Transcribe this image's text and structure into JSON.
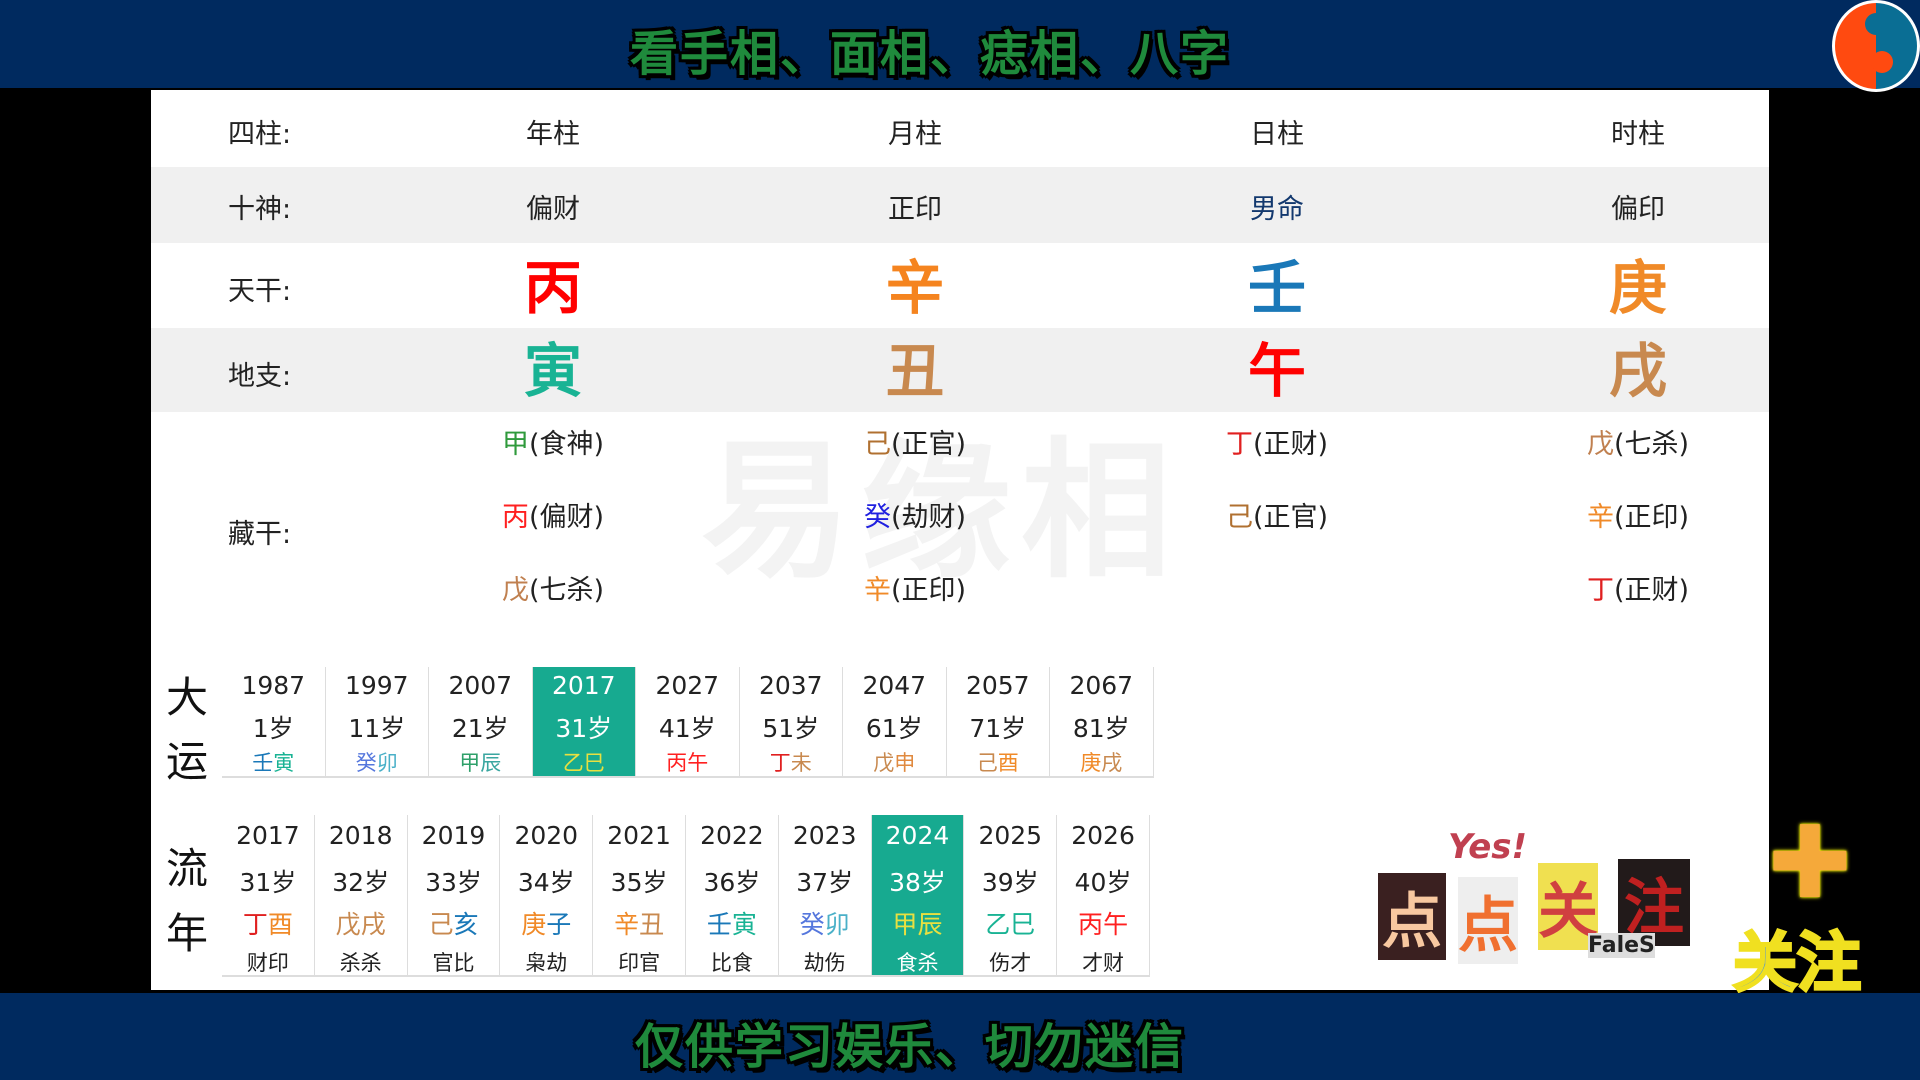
{
  "header": {
    "title": "看手相、面相、痣相、八字",
    "logo_icon": "yin-yang-icon"
  },
  "footer": {
    "title": "仅供学习娱乐、切勿迷信"
  },
  "watermark": "易缘相",
  "chart": {
    "pillars_label": "四柱:",
    "pillars": [
      "年柱",
      "月柱",
      "日柱",
      "时柱"
    ],
    "shishen_label": "十神:",
    "shishen": [
      "偏财",
      "正印",
      "男命",
      "偏印"
    ],
    "tiangan_label": "天干:",
    "tiangan": [
      {
        "t": "丙",
        "c": "#ff0000"
      },
      {
        "t": "辛",
        "c": "#f5841f"
      },
      {
        "t": "壬",
        "c": "#1a78b8"
      },
      {
        "t": "庚",
        "c": "#f08a28"
      }
    ],
    "dizhi_label": "地支:",
    "dizhi": [
      {
        "t": "寅",
        "c": "#19b394"
      },
      {
        "t": "丑",
        "c": "#c8894f"
      },
      {
        "t": "午",
        "c": "#ff0000"
      },
      {
        "t": "戌",
        "c": "#c8894f"
      }
    ],
    "canggan_label": "藏干:",
    "canggan": [
      [
        {
          "s": "甲",
          "c": "#2f9a3c",
          "g": "(食神)"
        },
        {
          "s": "丙",
          "c": "#ff2020",
          "g": "(偏财)"
        },
        {
          "s": "戊",
          "c": "#c08050",
          "g": "(七杀)"
        }
      ],
      [
        {
          "s": "己",
          "c": "#b07030",
          "g": "(正官)"
        },
        {
          "s": "癸",
          "c": "#2020e0",
          "g": "(劫财)"
        },
        {
          "s": "辛",
          "c": "#f08a28",
          "g": "(正印)"
        }
      ],
      [
        {
          "s": "丁",
          "c": "#e02020",
          "g": "(正财)"
        },
        {
          "s": "己",
          "c": "#b07030",
          "g": "(正官)"
        }
      ],
      [
        {
          "s": "戊",
          "c": "#c08050",
          "g": "(七杀)"
        },
        {
          "s": "辛",
          "c": "#f08a28",
          "g": "(正印)"
        },
        {
          "s": "丁",
          "c": "#e02020",
          "g": "(正财)"
        }
      ]
    ]
  },
  "dayun": {
    "label": [
      "大",
      "运"
    ],
    "selected": 3,
    "items": [
      {
        "year": "1987",
        "age": "1岁",
        "gz": [
          {
            "t": "壬",
            "c": "#1a78b8"
          },
          {
            "t": "寅",
            "c": "#19b394"
          }
        ]
      },
      {
        "year": "1997",
        "age": "11岁",
        "gz": [
          {
            "t": "癸",
            "c": "#5577dd"
          },
          {
            "t": "卯",
            "c": "#4ab0c8"
          }
        ]
      },
      {
        "year": "2007",
        "age": "21岁",
        "gz": [
          {
            "t": "甲",
            "c": "#2fa06a"
          },
          {
            "t": "辰",
            "c": "#3aa6a0"
          }
        ]
      },
      {
        "year": "2017",
        "age": "31岁",
        "gz": [
          {
            "t": "乙",
            "c": "#e8e040"
          },
          {
            "t": "巳",
            "c": "#e8e040"
          }
        ]
      },
      {
        "year": "2027",
        "age": "41岁",
        "gz": [
          {
            "t": "丙",
            "c": "#ff2020"
          },
          {
            "t": "午",
            "c": "#ff2020"
          }
        ]
      },
      {
        "year": "2037",
        "age": "51岁",
        "gz": [
          {
            "t": "丁",
            "c": "#e02020"
          },
          {
            "t": "未",
            "c": "#c8894f"
          }
        ]
      },
      {
        "year": "2047",
        "age": "61岁",
        "gz": [
          {
            "t": "戊",
            "c": "#c8894f"
          },
          {
            "t": "申",
            "c": "#e08a40"
          }
        ]
      },
      {
        "year": "2057",
        "age": "71岁",
        "gz": [
          {
            "t": "己",
            "c": "#c8894f"
          },
          {
            "t": "酉",
            "c": "#f08a28"
          }
        ]
      },
      {
        "year": "2067",
        "age": "81岁",
        "gz": [
          {
            "t": "庚",
            "c": "#f08a28"
          },
          {
            "t": "戌",
            "c": "#c8894f"
          }
        ]
      }
    ]
  },
  "liunian": {
    "label": [
      "流",
      "年"
    ],
    "selected": 7,
    "items": [
      {
        "year": "2017",
        "age": "31岁",
        "gz": [
          {
            "t": "丁",
            "c": "#e02020"
          },
          {
            "t": "酉",
            "c": "#f08a28"
          }
        ],
        "ss": "财印"
      },
      {
        "year": "2018",
        "age": "32岁",
        "gz": [
          {
            "t": "戊",
            "c": "#c8894f"
          },
          {
            "t": "戌",
            "c": "#c8894f"
          }
        ],
        "ss": "杀杀"
      },
      {
        "year": "2019",
        "age": "33岁",
        "gz": [
          {
            "t": "己",
            "c": "#c8894f"
          },
          {
            "t": "亥",
            "c": "#1a78b8"
          }
        ],
        "ss": "官比"
      },
      {
        "year": "2020",
        "age": "34岁",
        "gz": [
          {
            "t": "庚",
            "c": "#f08a28"
          },
          {
            "t": "子",
            "c": "#1a78b8"
          }
        ],
        "ss": "枭劫"
      },
      {
        "year": "2021",
        "age": "35岁",
        "gz": [
          {
            "t": "辛",
            "c": "#f08a28"
          },
          {
            "t": "丑",
            "c": "#c8894f"
          }
        ],
        "ss": "印官"
      },
      {
        "year": "2022",
        "age": "36岁",
        "gz": [
          {
            "t": "壬",
            "c": "#1a78b8"
          },
          {
            "t": "寅",
            "c": "#19b394"
          }
        ],
        "ss": "比食"
      },
      {
        "year": "2023",
        "age": "37岁",
        "gz": [
          {
            "t": "癸",
            "c": "#5577dd"
          },
          {
            "t": "卯",
            "c": "#4ab0c8"
          }
        ],
        "ss": "劫伤"
      },
      {
        "year": "2024",
        "age": "38岁",
        "gz": [
          {
            "t": "甲",
            "c": "#e8e040"
          },
          {
            "t": "辰",
            "c": "#e8e040"
          }
        ],
        "ss": "食杀"
      },
      {
        "year": "2025",
        "age": "39岁",
        "gz": [
          {
            "t": "乙",
            "c": "#19b394"
          },
          {
            "t": "巳",
            "c": "#19b394"
          }
        ],
        "ss": "伤才"
      },
      {
        "year": "2026",
        "age": "40岁",
        "gz": [
          {
            "t": "丙",
            "c": "#ff2020"
          },
          {
            "t": "午",
            "c": "#ff2020"
          }
        ],
        "ss": "才财"
      }
    ]
  },
  "follow": {
    "sticker_yes": "Yes!",
    "sticker": [
      "点",
      "点",
      "关",
      "注"
    ],
    "sticker_brand": "FaleS",
    "plus_icon": "plus-icon",
    "follow_label": "关注"
  }
}
